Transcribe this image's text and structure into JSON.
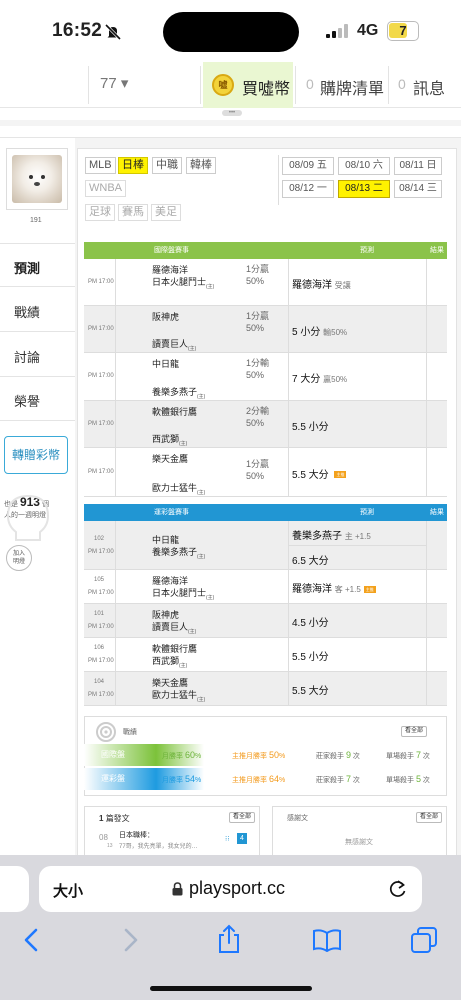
{
  "status": {
    "time": "16:52",
    "network": "4G",
    "battery": "7"
  },
  "nav": {
    "selector": "77 ▾",
    "buy": "買噓幣",
    "buy_coin": "噓",
    "cart_count": "0",
    "cart": "購牌清單",
    "msg_count": "0",
    "msg": "訊息"
  },
  "profile": {
    "uid": "191"
  },
  "menu": [
    "預測",
    "戰績",
    "討論",
    "榮譽"
  ],
  "gift": "轉贈彩幣",
  "viewers": {
    "pre": "也是",
    "count": "913",
    "mid": "個",
    "post": "人的一週明燈"
  },
  "add_btn": [
    "加入",
    "明燈"
  ],
  "leagues": {
    "row1": [
      "MLB",
      "日棒",
      "中職",
      "韓棒"
    ],
    "row2": [
      "WNBA"
    ],
    "row3": [
      "足球",
      "賽馬",
      "美足"
    ]
  },
  "dates": {
    "row1": [
      "08/09 五",
      "08/10 六",
      "08/11 日"
    ],
    "row2": [
      "08/12 一",
      "08/13 二",
      "08/14 三"
    ]
  },
  "intl": {
    "header": "國際盤賽事",
    "pred": "預測",
    "result": "結果",
    "rows": [
      {
        "time": "PM 17:00",
        "t1": "羅德海洋",
        "t2": "日本火腿鬥士",
        "t2s": "(主)",
        "odds1": "1分贏",
        "odds2": "50%",
        "pick": "羅德海洋",
        "note": "受讓",
        "badge": ""
      },
      {
        "time": "PM 17:00",
        "t1": "阪神虎",
        "t2": "讀賣巨人",
        "t2s": "(主)",
        "odds1": "1分贏",
        "odds2": "50%",
        "pick": "5 小分",
        "note": "輸50%",
        "badge": ""
      },
      {
        "time": "PM 17:00",
        "t1": "中日龍",
        "t2": "養樂多燕子",
        "t2s": "(主)",
        "odds1": "1分輸",
        "odds2": "50%",
        "pick": "7 大分",
        "note": "贏50%",
        "badge": ""
      },
      {
        "time": "PM 17:00",
        "t1": "軟體銀行鷹",
        "t2": "西武獅",
        "t2s": "(主)",
        "odds1": "2分輸",
        "odds2": "50%",
        "pick": "5.5 小分",
        "note": "",
        "badge": ""
      },
      {
        "time": "PM 17:00",
        "t1": "樂天金鷹",
        "t2": "歐力士猛牛",
        "t2s": "(主)",
        "odds1": "1分贏",
        "odds2": "50%",
        "pick": "5.5 大分",
        "note": "",
        "badge": "主推"
      }
    ]
  },
  "local": {
    "header": "運彩盤賽事",
    "pred": "預測",
    "result": "結果",
    "rows": [
      {
        "num": "102",
        "time": "PM 17:00",
        "t1": "中日龍",
        "t2": "養樂多燕子",
        "t2s": "(主)",
        "pick1": "養樂多燕子",
        "note1": "主 +1.5",
        "pick2": "6.5 大分",
        "badge": ""
      },
      {
        "num": "105",
        "time": "PM 17:00",
        "t1": "羅德海洋",
        "t2": "日本火腿鬥士",
        "t2s": "(主)",
        "pick1": "羅德海洋",
        "note1": "客 +1.5",
        "pick2": "",
        "badge": "主推"
      },
      {
        "num": "101",
        "time": "PM 17:00",
        "t1": "阪神虎",
        "t2": "讀賣巨人",
        "t2s": "(主)",
        "pick1": "4.5 小分",
        "note1": "",
        "pick2": "",
        "badge": ""
      },
      {
        "num": "106",
        "time": "PM 17:00",
        "t1": "軟體銀行鷹",
        "t2": "西武獅",
        "t2s": "(主)",
        "pick1": "5.5 小分",
        "note1": "",
        "pick2": "",
        "badge": ""
      },
      {
        "num": "104",
        "time": "PM 17:00",
        "t1": "樂天金鷹",
        "t2": "歐力士猛牛",
        "t2s": "(主)",
        "pick1": "5.5 大分",
        "note1": "",
        "pick2": "",
        "badge": ""
      }
    ]
  },
  "record": {
    "title": "戰績",
    "see_all": "看全部",
    "rows": [
      {
        "label": "國際盤",
        "rate_lbl": "月勝率",
        "rate": "60",
        "main_lbl": "主推月勝率",
        "main": "50",
        "streak_lbl": "莊家殺手",
        "streak": "9",
        "streak_unit": "次",
        "single_lbl": "單場殺手",
        "single": "7",
        "single_unit": "次"
      },
      {
        "label": "運彩盤",
        "rate_lbl": "月勝率",
        "rate": "54",
        "main_lbl": "主推月勝率",
        "main": "64",
        "streak_lbl": "莊家殺手",
        "streak": "7",
        "streak_unit": "次",
        "single_lbl": "單場殺手",
        "single": "5",
        "single_unit": "次"
      }
    ]
  },
  "posts": {
    "count": "1",
    "title": "篇發文",
    "see_all": "看全部",
    "date_m": "08",
    "date_d": "13",
    "item_title": "日本職棒：",
    "item_body": "77哥，我先亮單，我女兒的…",
    "item_replies": "4"
  },
  "thanks": {
    "title": "感謝文",
    "see_all": "看全部",
    "empty": "無感謝文"
  },
  "safari": {
    "text_size": "大小",
    "url": "playsport.cc"
  }
}
